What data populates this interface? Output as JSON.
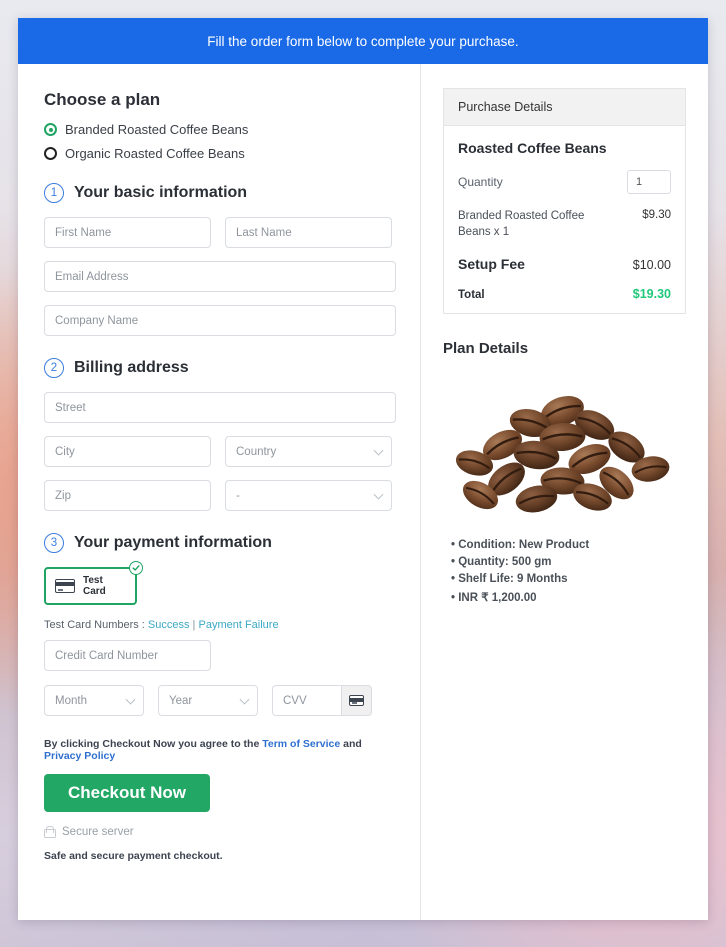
{
  "banner": {
    "text": "Fill the order form below to complete your purchase."
  },
  "plan": {
    "heading": "Choose a plan",
    "options": [
      {
        "label": "Branded Roasted Coffee Beans",
        "selected": true
      },
      {
        "label": "Organic Roasted Coffee Beans",
        "selected": false
      }
    ]
  },
  "steps": {
    "basic": {
      "number": "1",
      "title": "Your basic information",
      "first_name_placeholder": "First Name",
      "last_name_placeholder": "Last Name",
      "email_placeholder": "Email Address",
      "company_placeholder": "Company Name"
    },
    "billing": {
      "number": "2",
      "title": "Billing address",
      "street_placeholder": "Street",
      "city_placeholder": "City",
      "country_placeholder": "Country",
      "zip_placeholder": "Zip",
      "state_placeholder": "-"
    },
    "payment": {
      "number": "3",
      "title": "Your payment information",
      "tile_label": "Test  Card",
      "tile_icon": "credit-card-icon",
      "tile_badge_icon": "check-circle-icon",
      "testcards_prefix": "Test Card Numbers : ",
      "testcards_success": "Success",
      "testcards_separator": " | ",
      "testcards_failure": "Payment Failure",
      "card_number_placeholder": "Credit Card Number",
      "month_placeholder": "Month",
      "year_placeholder": "Year",
      "cvv_placeholder": "CVV",
      "cvv_icon": "credit-card-icon"
    }
  },
  "footer": {
    "terms_prefix": "By clicking Checkout Now you agree to the ",
    "terms_link": "Term of Service",
    "terms_mid": " and ",
    "privacy_link": "Privacy Policy",
    "checkout_label": "Checkout Now",
    "secure_icon": "lock-icon",
    "secure_text": "Secure server",
    "safe_text": "Safe and secure payment checkout."
  },
  "purchase_details": {
    "header": "Purchase Details",
    "product_title": "Roasted Coffee Beans",
    "quantity_label": "Quantity",
    "quantity_value": "1",
    "line_item_name": "Branded Roasted Coffee Beans x 1",
    "line_item_amount": "$9.30",
    "setup_fee_label": "Setup Fee",
    "setup_fee_amount": "$10.00",
    "total_label": "Total",
    "total_amount": "$19.30"
  },
  "plan_details": {
    "title": "Plan Details",
    "image_alt": "roasted-coffee-beans-pile",
    "bullets": [
      "Condition: New Product",
      "Quantity: 500 gm",
      "Shelf Life: 9 Months",
      "INR ₹ 1,200.00"
    ]
  },
  "colors": {
    "banner_blue": "#1a6ae8",
    "accent_green": "#23a765",
    "total_green": "#1fc87a",
    "step_blue": "#3b7ddd",
    "link_teal": "#3aa8c4"
  }
}
